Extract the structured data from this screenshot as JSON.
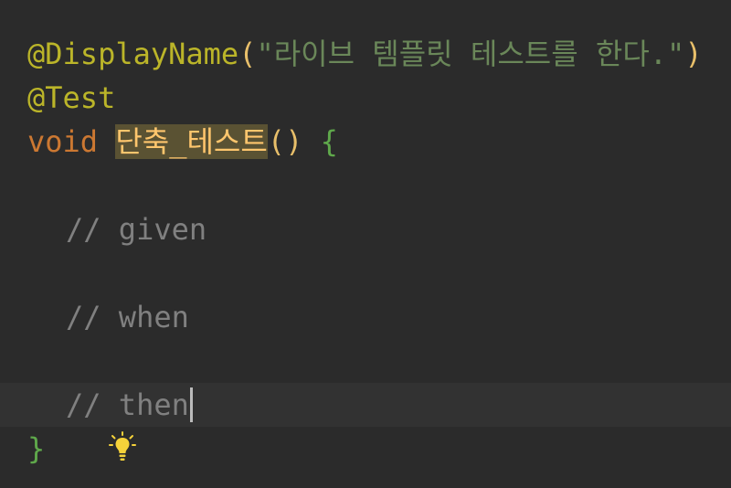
{
  "editor": {
    "lines": {
      "l1": {
        "annotation": "@DisplayName",
        "open_paren": "(",
        "string": "\"라이브 템플릿 테스트를 한다.\"",
        "close_paren": ")"
      },
      "l2": {
        "annotation": "@Test"
      },
      "l3": {
        "keyword": "void",
        "method": "단축_테스트",
        "parens": "()",
        "brace": "{"
      },
      "l5": {
        "comment": "// given"
      },
      "l7": {
        "comment": "// when"
      },
      "l9": {
        "comment": "// then"
      },
      "l10": {
        "brace": "}"
      }
    },
    "icons": {
      "intention_bulb": "lightbulb-icon"
    },
    "colors": {
      "background": "#2b2b2b",
      "current_line": "#323232",
      "annotation": "#bbb529",
      "string": "#6a8759",
      "keyword": "#cc7832",
      "method_highlight_bg": "#5a5233",
      "method_text": "#ffc66d",
      "brace": "#5fa84b",
      "comment": "#808080",
      "bulb": "#f5d23a"
    }
  }
}
